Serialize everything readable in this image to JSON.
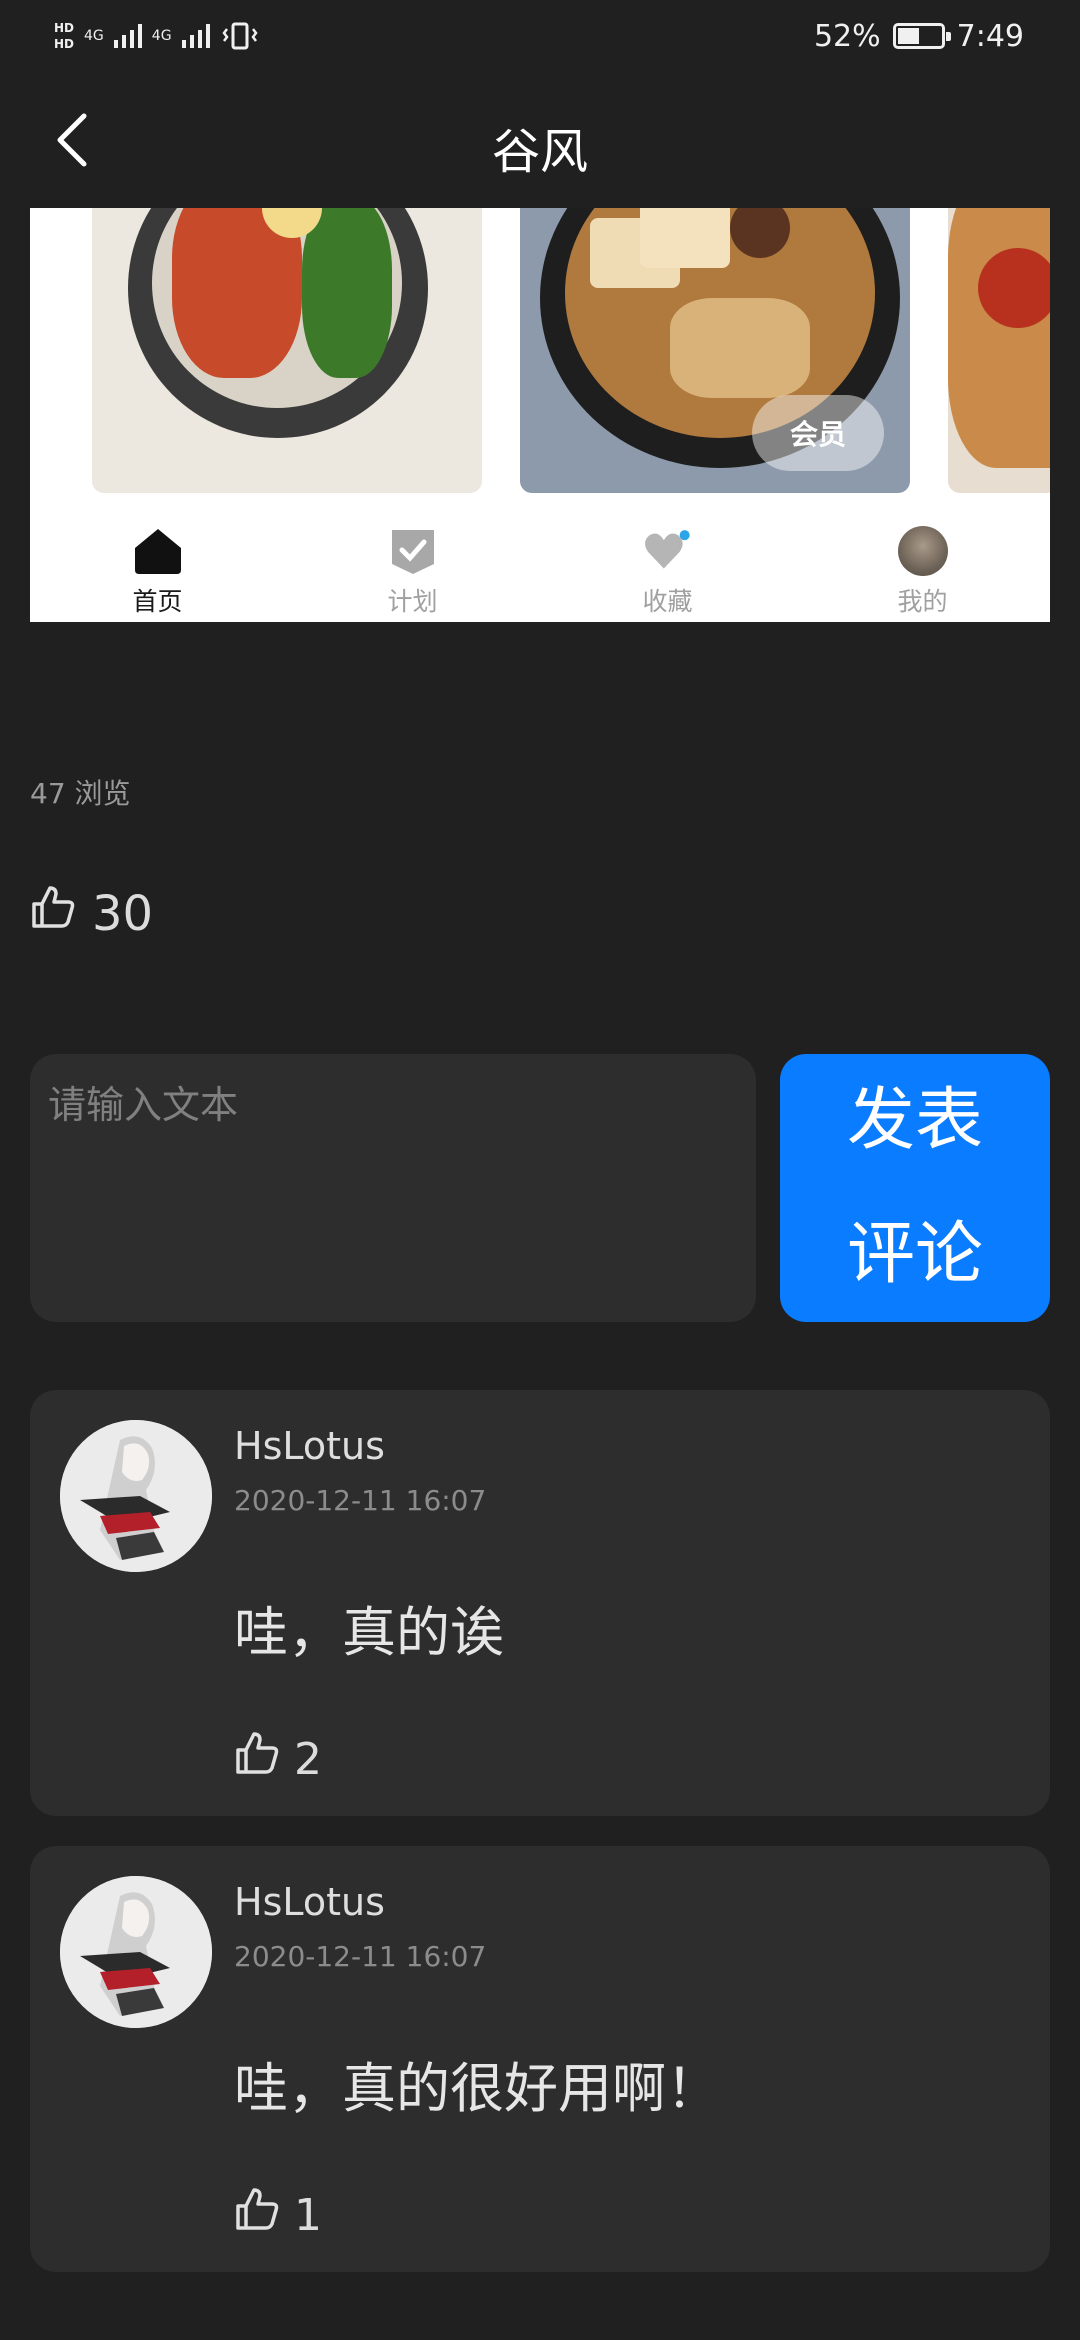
{
  "status_bar": {
    "hd1": "HD",
    "hd2": "HD",
    "net1": "4G",
    "net2": "4G",
    "battery_percent": "52%",
    "battery_level": 0.52,
    "time": "7:49"
  },
  "header": {
    "title": "谷风"
  },
  "screenshot": {
    "vip_badge": "会员",
    "tabs": [
      {
        "label": "首页",
        "icon": "home-icon",
        "active": true
      },
      {
        "label": "计划",
        "icon": "checklist-icon",
        "active": false
      },
      {
        "label": "收藏",
        "icon": "heart-icon",
        "active": false
      },
      {
        "label": "我的",
        "icon": "avatar-icon",
        "active": false
      }
    ]
  },
  "post": {
    "views": "47 浏览",
    "like_count": "30"
  },
  "composer": {
    "placeholder": "请输入文本",
    "submit_label": "发表评论"
  },
  "comments": [
    {
      "user": "HsLotus",
      "time": "2020-12-11 16:07",
      "text": "哇，真的诶",
      "likes": "2"
    },
    {
      "user": "HsLotus",
      "time": "2020-12-11 16:07",
      "text": "哇，真的很好用啊！",
      "likes": "1"
    }
  ],
  "colors": {
    "background": "#202020",
    "card": "#2d2d2d",
    "accent": "#0a7cff"
  }
}
